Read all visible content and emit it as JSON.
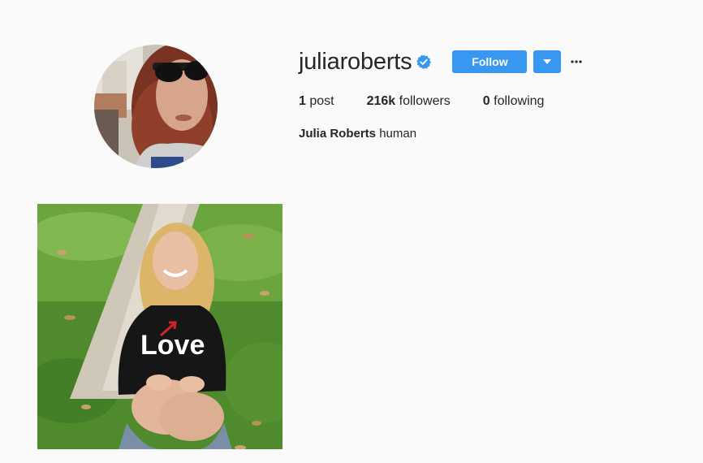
{
  "profile": {
    "username": "juliaroberts",
    "verified": true,
    "full_name": "Julia Roberts",
    "bio": "human",
    "stats": {
      "posts_count": "1",
      "posts_label": "post",
      "followers_count": "216k",
      "followers_label": "followers",
      "following_count": "0",
      "following_label": "following"
    }
  },
  "actions": {
    "follow_label": "Follow",
    "dropdown_icon": "caret-down-icon",
    "more_icon": "ellipsis-icon"
  },
  "posts": [
    {
      "type": "image",
      "description_icon": "photo"
    }
  ],
  "colors": {
    "background": "#fafafa",
    "accent": "#3897f0",
    "text": "#262626"
  }
}
